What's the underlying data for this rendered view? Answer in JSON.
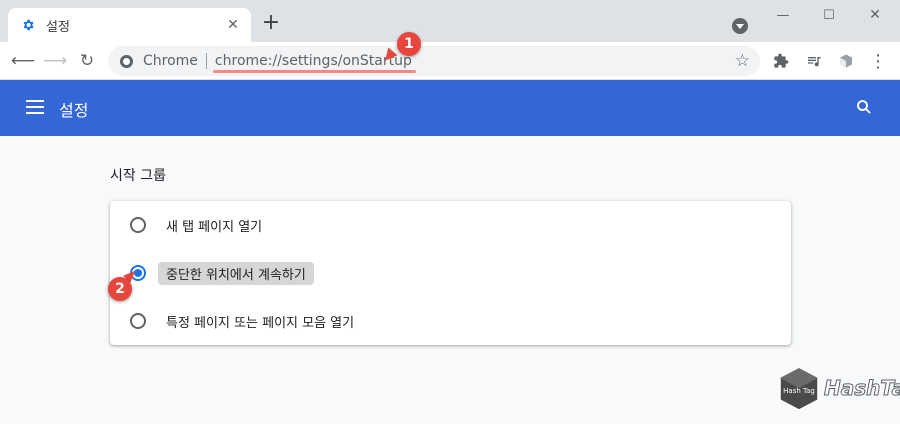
{
  "tab": {
    "title": "설정",
    "close_icon": "close-icon",
    "favicon": "gear-icon"
  },
  "window": {
    "minimize": "—",
    "maximize": "☐",
    "close": "✕"
  },
  "toolbar": {
    "scheme_label": "Chrome",
    "url": "chrome://settings/onStartup"
  },
  "header": {
    "title": "설정"
  },
  "startup": {
    "section_title": "시작 그룹",
    "options": [
      {
        "label": "새 탭 페이지 열기",
        "selected": false
      },
      {
        "label": "중단한 위치에서 계속하기",
        "selected": true
      },
      {
        "label": "특정 페이지 또는 페이지 모음 열기",
        "selected": false
      }
    ]
  },
  "callouts": {
    "one": "1",
    "two": "2"
  },
  "watermark": {
    "text": "HashTag",
    "cube_text": "Hash Tag"
  },
  "colors": {
    "header_bg": "#3367d6",
    "accent": "#1a73e8",
    "callout": "#e8453c"
  }
}
